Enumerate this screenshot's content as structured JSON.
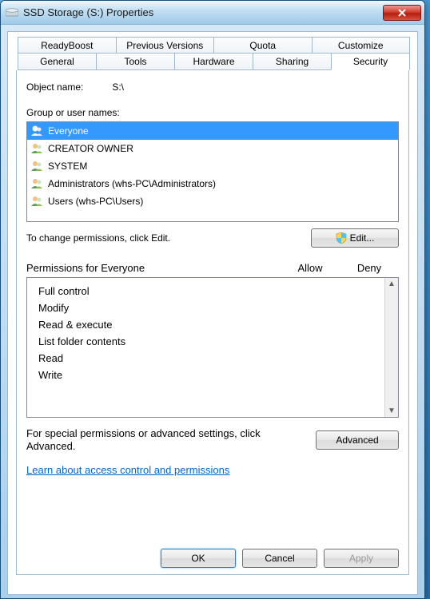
{
  "window": {
    "title": "SSD Storage (S:) Properties"
  },
  "tabs_row1": [
    "ReadyBoost",
    "Previous Versions",
    "Quota",
    "Customize"
  ],
  "tabs_row2": [
    "General",
    "Tools",
    "Hardware",
    "Sharing",
    "Security"
  ],
  "object": {
    "label": "Object name:",
    "value": "S:\\"
  },
  "group_label": "Group or user names:",
  "users": [
    {
      "name": "Everyone"
    },
    {
      "name": "CREATOR OWNER"
    },
    {
      "name": "SYSTEM"
    },
    {
      "name": "Administrators (whs-PC\\Administrators)"
    },
    {
      "name": "Users (whs-PC\\Users)"
    }
  ],
  "edit_hint": "To change permissions, click Edit.",
  "edit_button": "Edit...",
  "perm_header": {
    "label": "Permissions for Everyone",
    "allow": "Allow",
    "deny": "Deny"
  },
  "permissions": [
    "Full control",
    "Modify",
    "Read & execute",
    "List folder contents",
    "Read",
    "Write"
  ],
  "advanced_hint": "For special permissions or advanced settings, click Advanced.",
  "advanced_button": "Advanced",
  "help_link": "Learn about access control and permissions",
  "buttons": {
    "ok": "OK",
    "cancel": "Cancel",
    "apply": "Apply"
  }
}
